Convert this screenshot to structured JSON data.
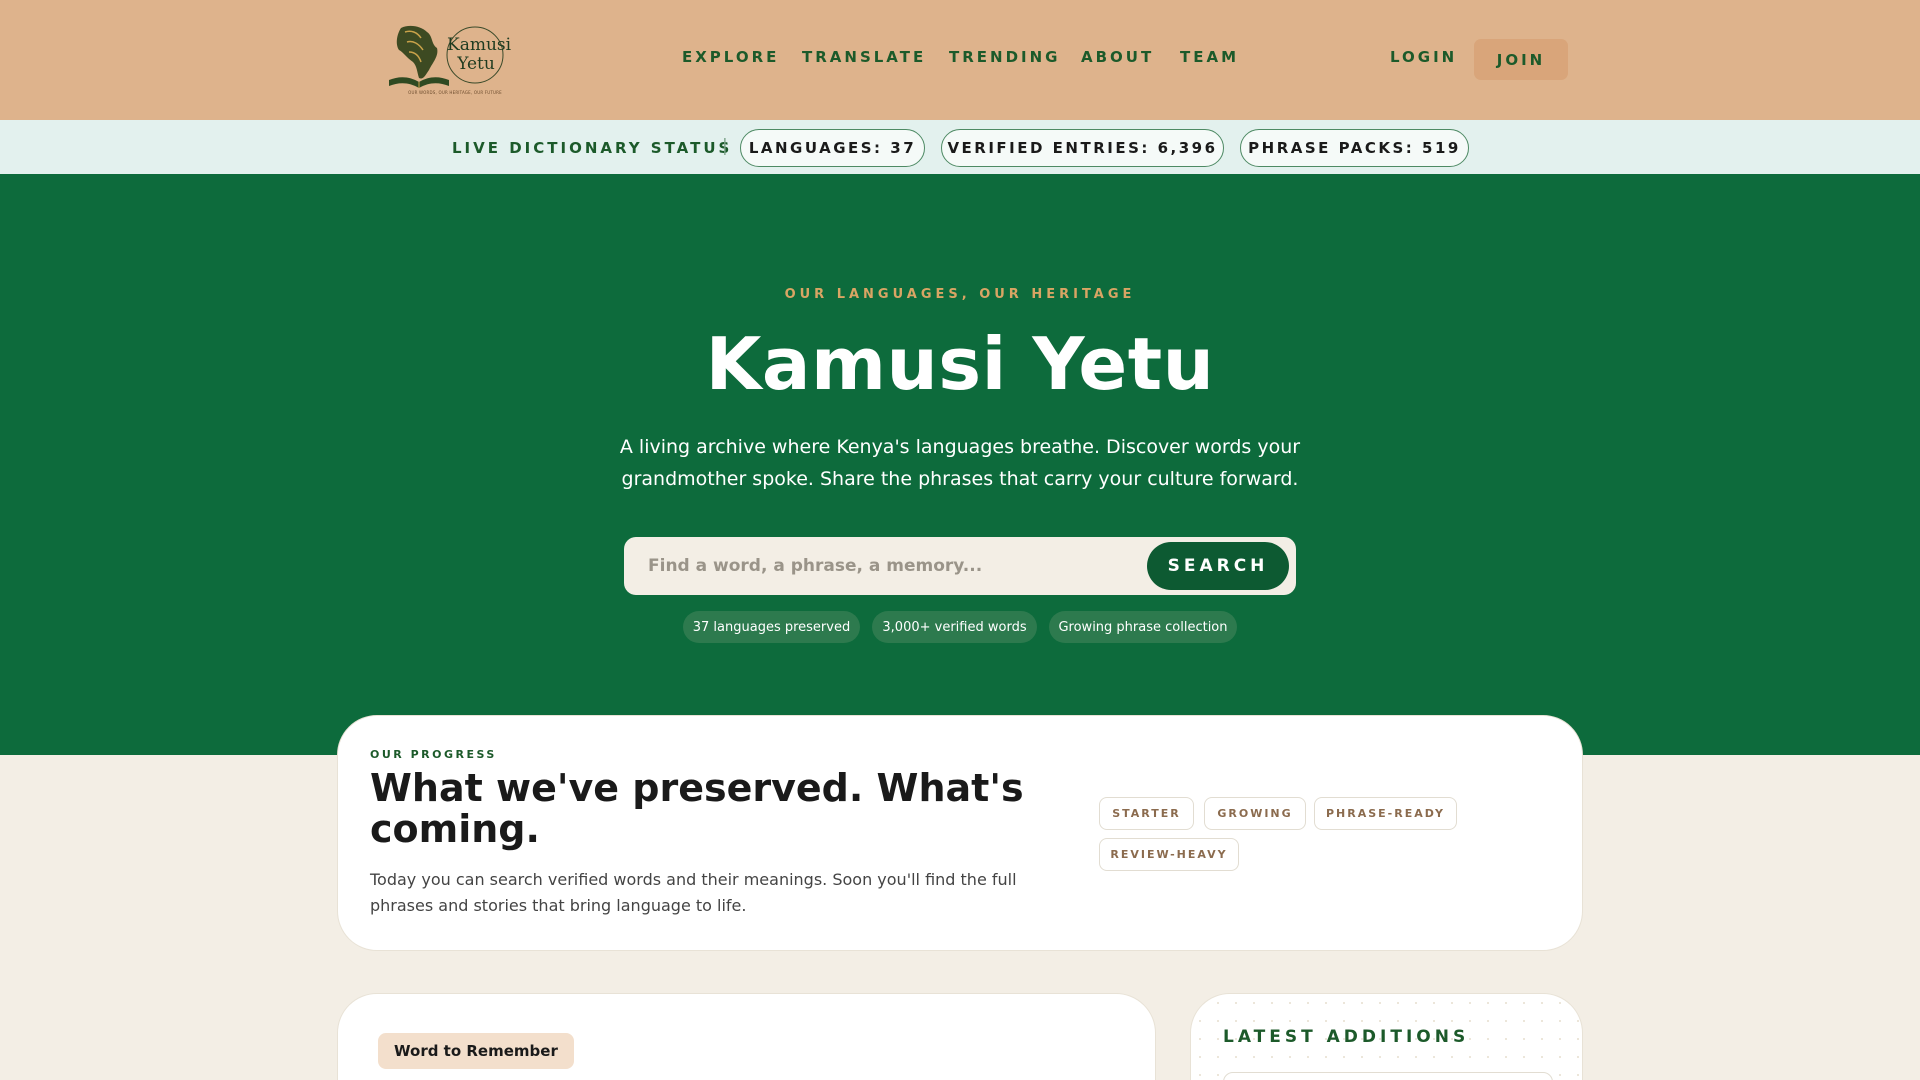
{
  "header": {
    "logo": {
      "name_line1": "Kamusi",
      "name_line2": "Yetu",
      "tagline": "OUR WORDS, OUR HERITAGE, OUR FUTURE"
    },
    "nav": [
      "EXPLORE",
      "TRANSLATE",
      "TRENDING",
      "ABOUT",
      "TEAM"
    ],
    "login_label": "LOGIN",
    "join_label": "JOIN"
  },
  "status_bar": {
    "label": "LIVE DICTIONARY STATUS",
    "divider": "|",
    "pills": [
      "LANGUAGES: 37",
      "VERIFIED ENTRIES: 6,396",
      "PHRASE PACKS: 519"
    ]
  },
  "hero": {
    "kicker": "OUR LANGUAGES, OUR HERITAGE",
    "title": "Kamusi Yetu",
    "subtitle": "A living archive where Kenya's languages breathe. Discover words your grandmother spoke. Share the phrases that carry your culture forward.",
    "search": {
      "placeholder": "Find a word, a phrase, a memory...",
      "button_label": "SEARCH"
    },
    "chips": [
      "37 languages preserved",
      "3,000+ verified words",
      "Growing phrase collection"
    ]
  },
  "progress": {
    "kicker": "OUR PROGRESS",
    "title": "What we've preserved. What's coming.",
    "text": "Today you can search verified words and their meanings. Soon you'll find the full phrases and stories that bring language to life.",
    "levels": [
      "STARTER",
      "GROWING",
      "PHRASE-READY",
      "REVIEW-HEAVY"
    ]
  },
  "word_card": {
    "badge": "Word to Remember"
  },
  "latest": {
    "title": "LATEST ADDITIONS"
  },
  "colors": {
    "header_bg": "#deb38c",
    "hero_bg": "#0d6b3c",
    "accent_green": "#1c5a2a",
    "accent_gold": "#d9a564",
    "page_bg": "#f3eee5"
  },
  "icons": {
    "logo_mark": "africa-map-tree-book-icon"
  }
}
